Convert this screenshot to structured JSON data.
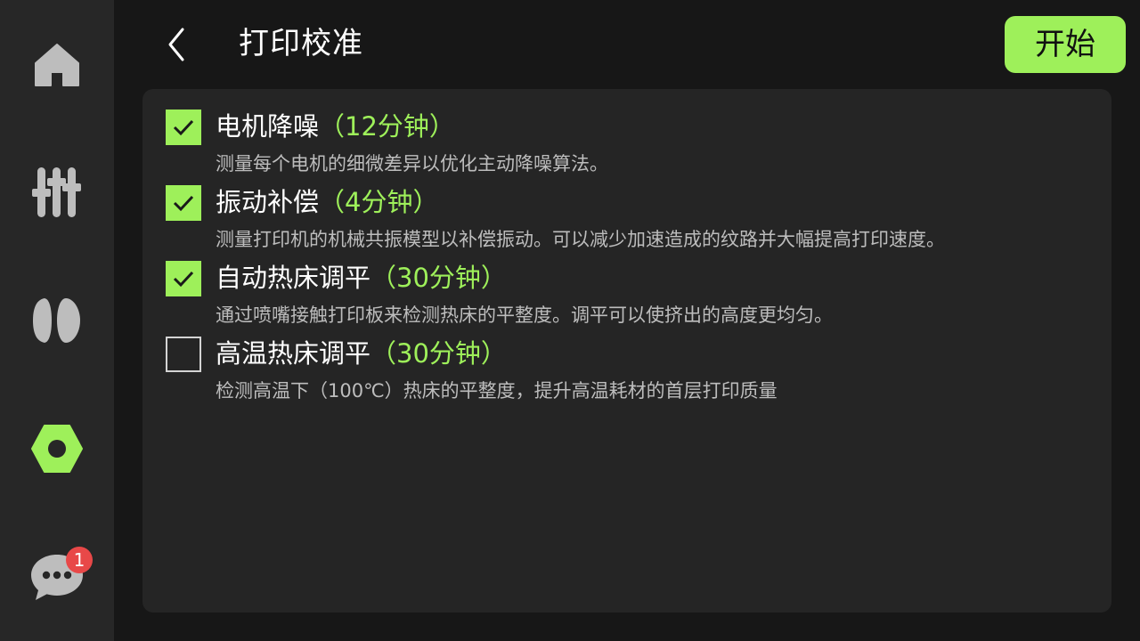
{
  "sidebar": {
    "items": [
      {
        "name": "home",
        "icon": "home-icon",
        "active": false
      },
      {
        "name": "controls",
        "icon": "sliders-icon",
        "active": false
      },
      {
        "name": "filament",
        "icon": "filament-spool-icon",
        "active": false
      },
      {
        "name": "settings",
        "icon": "hex-nut-icon",
        "active": true
      },
      {
        "name": "messages",
        "icon": "chat-bubble-icon",
        "active": false,
        "badge": "1"
      }
    ]
  },
  "header": {
    "back_icon": "chevron-left-icon",
    "title": "打印校准",
    "start_label": "开始"
  },
  "options": [
    {
      "title": "电机降噪",
      "time": "（12分钟）",
      "description": "测量每个电机的细微差异以优化主动降噪算法。",
      "checked": true
    },
    {
      "title": "振动补偿",
      "time": "（4分钟）",
      "description": "测量打印机的机械共振模型以补偿振动。可以减少加速造成的纹路并大幅提高打印速度。",
      "checked": true
    },
    {
      "title": "自动热床调平",
      "time": "（30分钟）",
      "description": "通过喷嘴接触打印板来检测热床的平整度。调平可以使挤出的高度更均匀。",
      "checked": true
    },
    {
      "title": "高温热床调平",
      "time": "（30分钟）",
      "description": "检测高温下（100℃）热床的平整度，提升高温耗材的首层打印质量",
      "checked": false
    }
  ],
  "colors": {
    "accent": "#9ef05a",
    "background": "#171717",
    "sidebar": "#272727",
    "panel": "#252525",
    "badge": "#e84848"
  }
}
